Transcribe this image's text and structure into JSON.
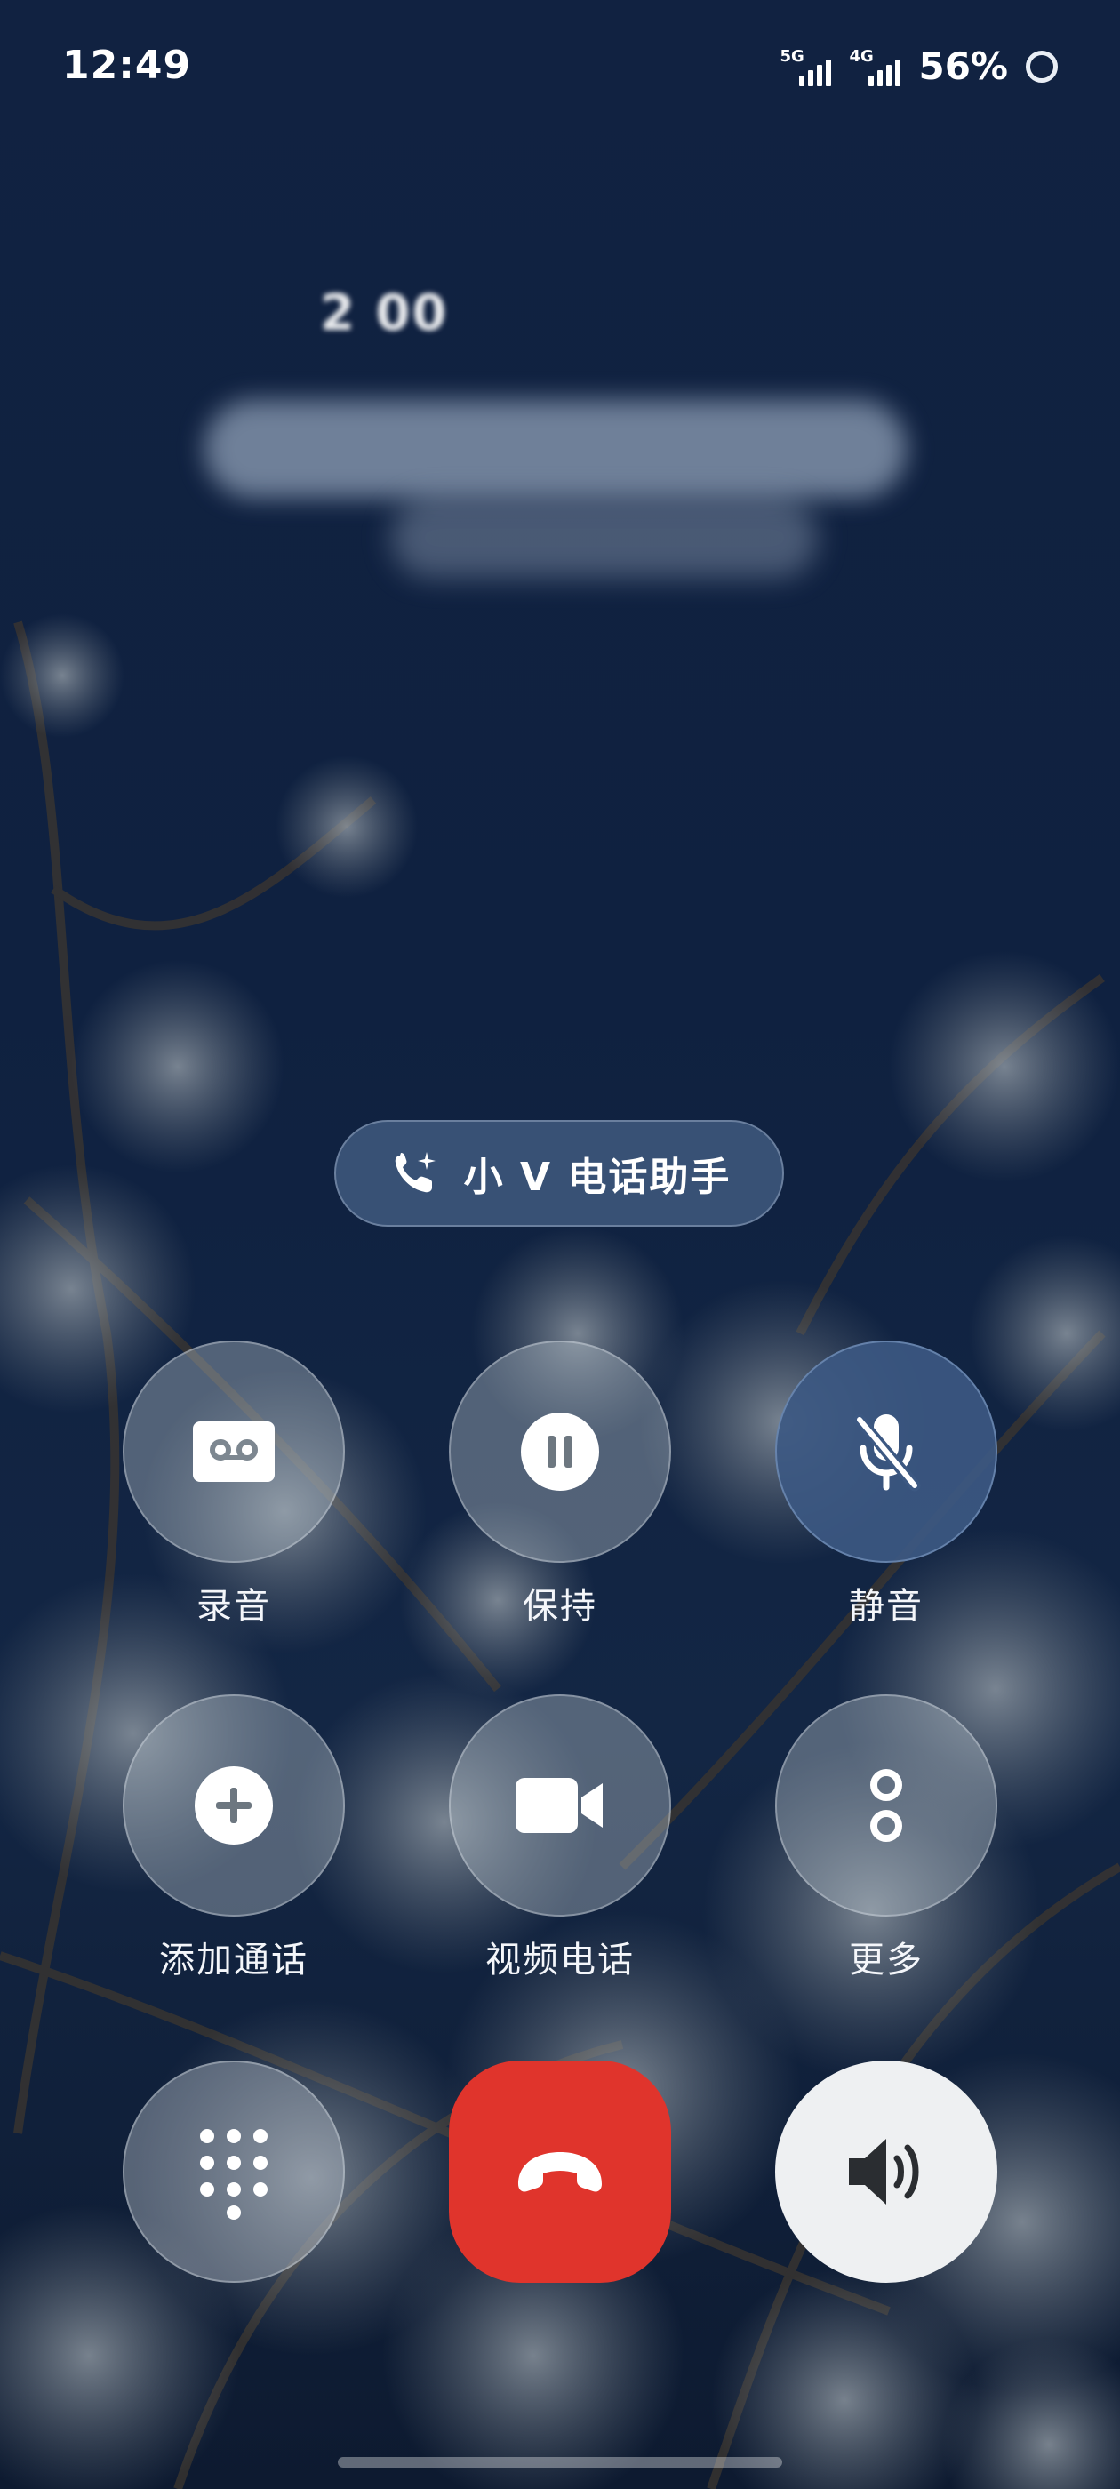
{
  "status_bar": {
    "time": "12:49",
    "network_1": "5G",
    "network_2": "4G",
    "battery": "56%"
  },
  "caller": {
    "number_visible": "2 00"
  },
  "assistant": {
    "label": "小 V 电话助手",
    "icon": "phone-sparkle-icon"
  },
  "controls": [
    {
      "label": "录音",
      "icon": "cassette-record-icon",
      "active": false
    },
    {
      "label": "保持",
      "icon": "pause-icon",
      "active": false
    },
    {
      "label": "静音",
      "icon": "mic-off-icon",
      "active": true
    },
    {
      "label": "添加通话",
      "icon": "add-call-icon",
      "active": false
    },
    {
      "label": "视频电话",
      "icon": "video-camera-icon",
      "active": false
    },
    {
      "label": "更多",
      "icon": "more-dots-icon",
      "active": false
    }
  ],
  "bottom": {
    "dialpad_icon": "dialpad-icon",
    "hangup_icon": "hang-up-icon",
    "speaker_icon": "speaker-icon"
  },
  "colors": {
    "background": "#112241",
    "hangup": "#e0342c",
    "speaker_bg": "#eef0f2",
    "muted_bg": "#3c5882"
  }
}
